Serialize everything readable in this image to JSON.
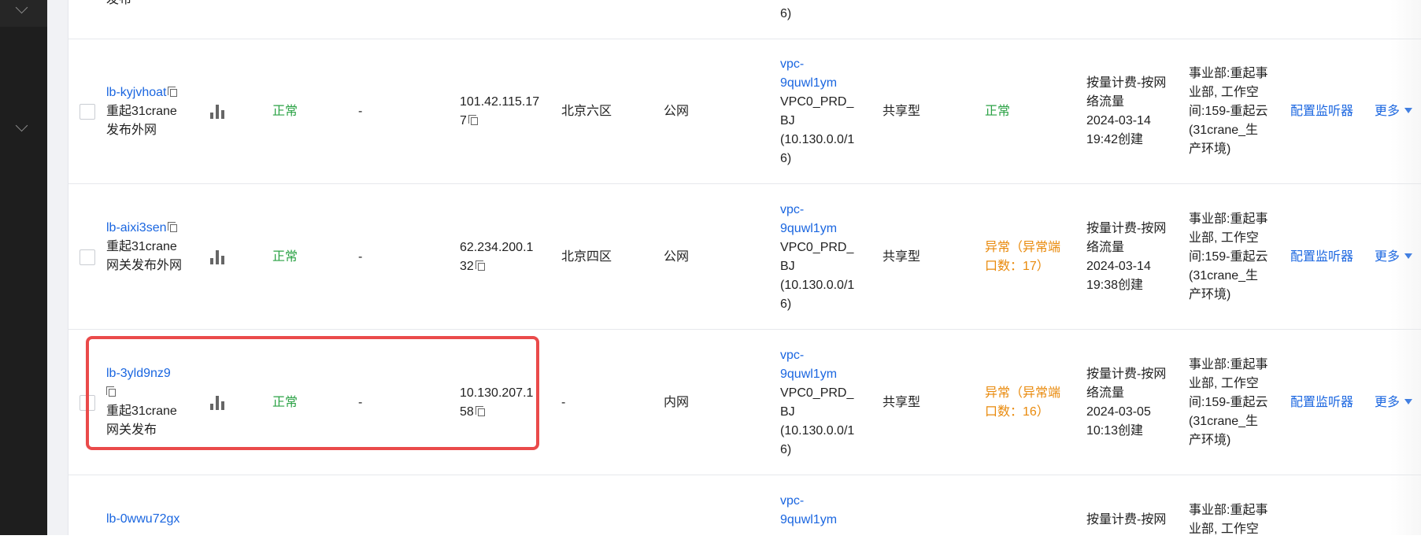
{
  "top_partial": {
    "name_cut": "发布",
    "vpc_tail": "6)"
  },
  "rows": [
    {
      "id": "lb-kyjvhoat",
      "name": [
        "重起31crane",
        "发布外网"
      ],
      "health": "正常",
      "dash1": "-",
      "vip": [
        "101.42.115.17",
        "7"
      ],
      "zone": "北京六区",
      "net": "公网",
      "vpc_id": [
        "vpc-",
        "9quwl1ym"
      ],
      "vpc_info": [
        "VPC0_PRD_",
        "BJ",
        "(10.130.0.0/1",
        "6)"
      ],
      "spec": "共享型",
      "status": [
        "正常"
      ],
      "billing": [
        "按量计费-按网",
        "络流量",
        "2024-03-14",
        "19:42创建"
      ],
      "project": [
        "事业部:重起事",
        "业部, 工作空",
        "间:159-重起云",
        "(31crane_生",
        "产环境)"
      ],
      "action": "配置监听器",
      "more": "更多"
    },
    {
      "id": "lb-aixi3sen",
      "name": [
        "重起31crane",
        "网关发布外网"
      ],
      "health": "正常",
      "dash1": "-",
      "vip": [
        "62.234.200.1",
        "32"
      ],
      "zone": "北京四区",
      "net": "公网",
      "vpc_id": [
        "vpc-",
        "9quwl1ym"
      ],
      "vpc_info": [
        "VPC0_PRD_",
        "BJ",
        "(10.130.0.0/1",
        "6)"
      ],
      "spec": "共享型",
      "status": [
        "异常（异常端",
        "口数：17）"
      ],
      "billing": [
        "按量计费-按网",
        "络流量",
        "2024-03-14",
        "19:38创建"
      ],
      "project": [
        "事业部:重起事",
        "业部, 工作空",
        "间:159-重起云",
        "(31crane_生",
        "产环境)"
      ],
      "action": "配置监听器",
      "more": "更多"
    },
    {
      "id": "lb-3yld9nz9",
      "name": [
        "重起31crane",
        "网关发布"
      ],
      "health": "正常",
      "dash1": "-",
      "vip": [
        "10.130.207.1",
        "58"
      ],
      "zone": "-",
      "net": "内网",
      "vpc_id": [
        "vpc-",
        "9quwl1ym"
      ],
      "vpc_info": [
        "VPC0_PRD_",
        "BJ",
        "(10.130.0.0/1",
        "6)"
      ],
      "spec": "共享型",
      "status": [
        "异常（异常端",
        "口数：16）"
      ],
      "billing": [
        "按量计费-按网",
        "络流量",
        "2024-03-05",
        "10:13创建"
      ],
      "project": [
        "事业部:重起事",
        "业部, 工作空",
        "间:159-重起云",
        "(31crane_生",
        "产环境)"
      ],
      "action": "配置监听器",
      "more": "更多"
    }
  ],
  "bottom_partial": {
    "id": "lb-0wwu72gx",
    "vpc_id": [
      "vpc-",
      "9quwl1ym"
    ],
    "billing_first": "按量计费-按网",
    "project": [
      "事业部:重起事",
      "业部, 工作空"
    ]
  },
  "colors": {
    "link": "#1a66e0",
    "ok": "#2ba245",
    "warn": "#e98a0c",
    "highlight": "#ea4a4a"
  },
  "icons": [
    "copy-icon",
    "monitor-bar-chart-icon",
    "chevron-down-icon",
    "caret-down-icon"
  ]
}
